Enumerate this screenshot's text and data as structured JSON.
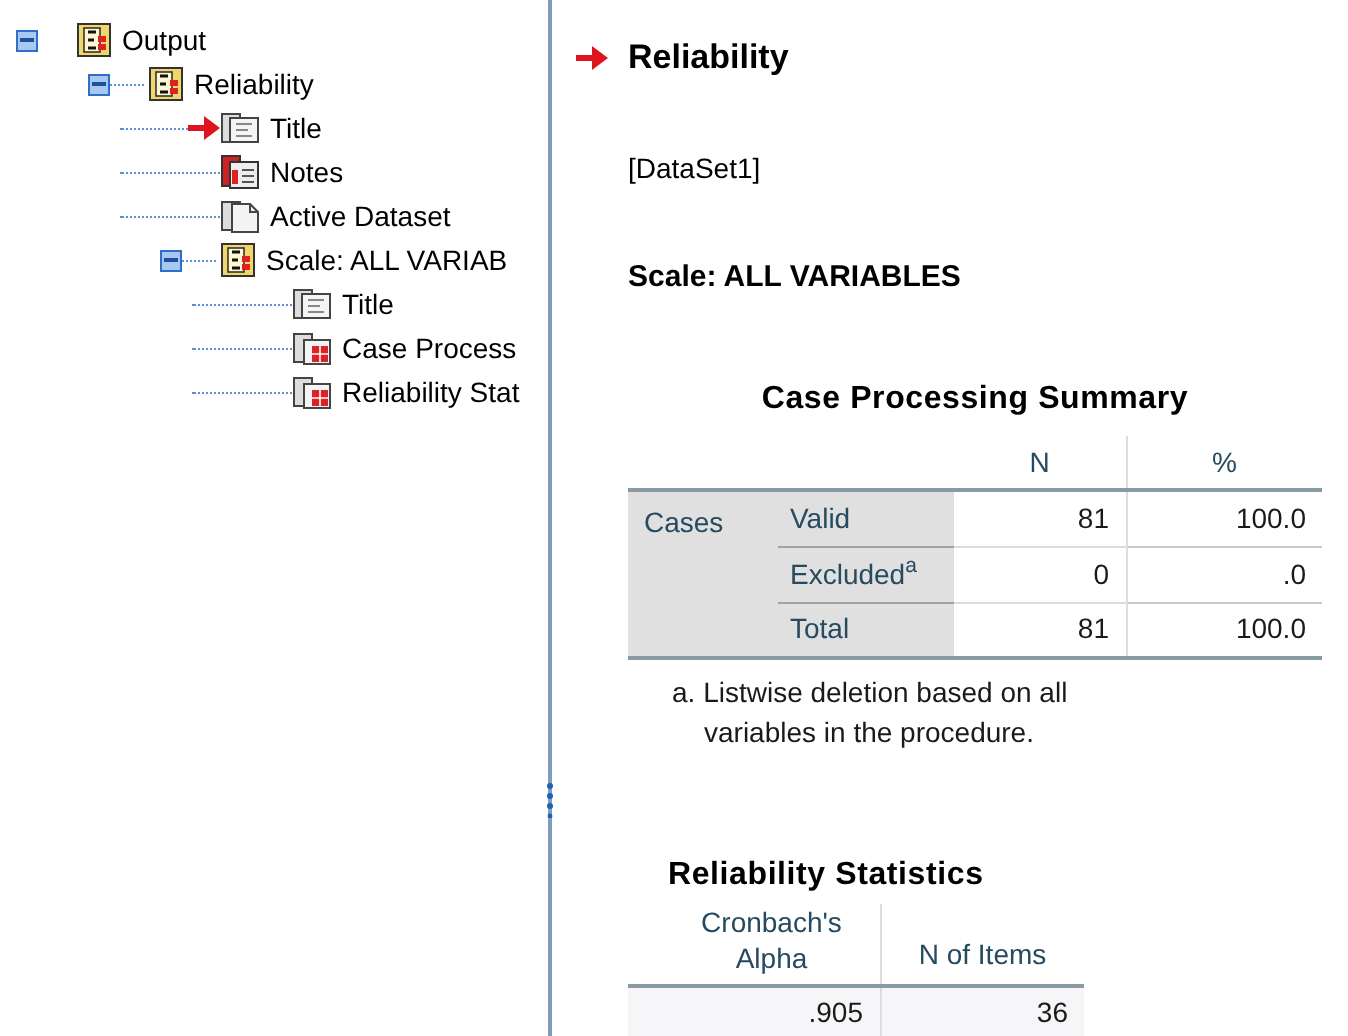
{
  "tree": [
    {
      "label": "Output",
      "kind": "book",
      "expanded": true,
      "current": false,
      "children": [
        {
          "label": "Reliability",
          "kind": "book",
          "expanded": true,
          "current": false,
          "children": [
            {
              "label": "Title",
              "kind": "title",
              "current": true
            },
            {
              "label": "Notes",
              "kind": "notes",
              "current": false
            },
            {
              "label": "Active Dataset",
              "kind": "doc",
              "current": false
            },
            {
              "label": "Scale: ALL VARIAB",
              "kind": "book",
              "expanded": true,
              "current": false,
              "children": [
                {
                  "label": "Title",
                  "kind": "title",
                  "current": false
                },
                {
                  "label": "Case Process",
                  "kind": "table",
                  "current": false
                },
                {
                  "label": "Reliability Stat",
                  "kind": "table",
                  "current": false
                }
              ]
            }
          ]
        }
      ]
    }
  ],
  "viewer": {
    "heading": "Reliability",
    "current": true,
    "dataset": "[DataSet1]",
    "scale_title": "Scale: ALL VARIABLES",
    "case_summary": {
      "title": "Case Processing Summary",
      "columns": [
        "N",
        "%"
      ],
      "group": "Cases",
      "rows": [
        {
          "label": "Valid",
          "values": [
            "81",
            "100.0"
          ]
        },
        {
          "label": "Excluded$^{a}$",
          "values": [
            "0",
            ".0"
          ]
        },
        {
          "label": "Total",
          "values": [
            "81",
            "100.0"
          ]
        }
      ],
      "footnote": "a. Listwise deletion based on all variables in the procedure."
    },
    "reliability": {
      "title": "Reliability Statistics",
      "columns": [
        "Cronbach's Alpha",
        "N of Items"
      ],
      "values": [
        ".905",
        "36"
      ]
    }
  }
}
